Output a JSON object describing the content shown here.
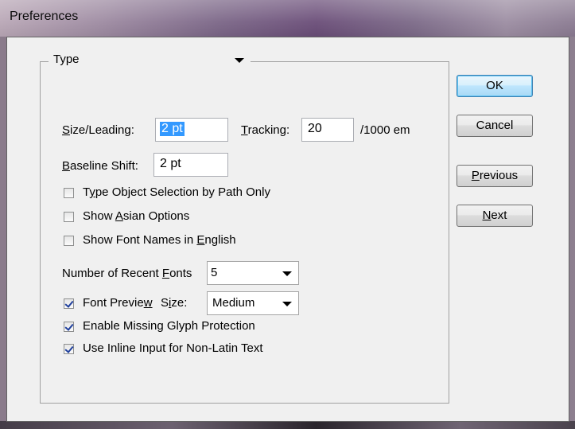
{
  "window": {
    "title": "Preferences"
  },
  "section": {
    "selected": "Type"
  },
  "size_leading": {
    "label_pre": "S",
    "label_rest": "ize/Leading:",
    "value": "2 pt"
  },
  "tracking": {
    "label_pre": "T",
    "label_rest": "racking:",
    "value": "20",
    "unit": "/1000 em"
  },
  "baseline_shift": {
    "label_pre": "B",
    "label_rest": "aseline Shift:",
    "value": "2 pt"
  },
  "checkboxes": {
    "type_object": {
      "pre": "T",
      "u": "y",
      "post": "pe Object Selection by Path Only",
      "checked": false
    },
    "asian": {
      "pre": "Show ",
      "u": "A",
      "post": "sian Options",
      "checked": false
    },
    "font_names": {
      "pre": "Show Font Names in ",
      "u": "E",
      "post": "nglish",
      "checked": false
    },
    "font_preview": {
      "pre": "Font Previe",
      "u": "w",
      "post": "",
      "checked": true
    },
    "missing_glyph": {
      "pre": "Enable Missing Glyph Protection",
      "u": "",
      "post": "",
      "checked": true
    },
    "inline_input": {
      "pre": "Use Inline Input for Non-Latin Text",
      "u": "",
      "post": "",
      "checked": true
    }
  },
  "recent_fonts": {
    "pre": "Number of Recent ",
    "u": "F",
    "post": "onts",
    "value": "5"
  },
  "preview_size": {
    "pre": "S",
    "u": "i",
    "post": "ze:",
    "value": "Medium"
  },
  "buttons": {
    "ok": "OK",
    "cancel": "Cancel",
    "previous_u": "P",
    "previous_rest": "revious",
    "next_u": "N",
    "next_rest": "ext"
  }
}
